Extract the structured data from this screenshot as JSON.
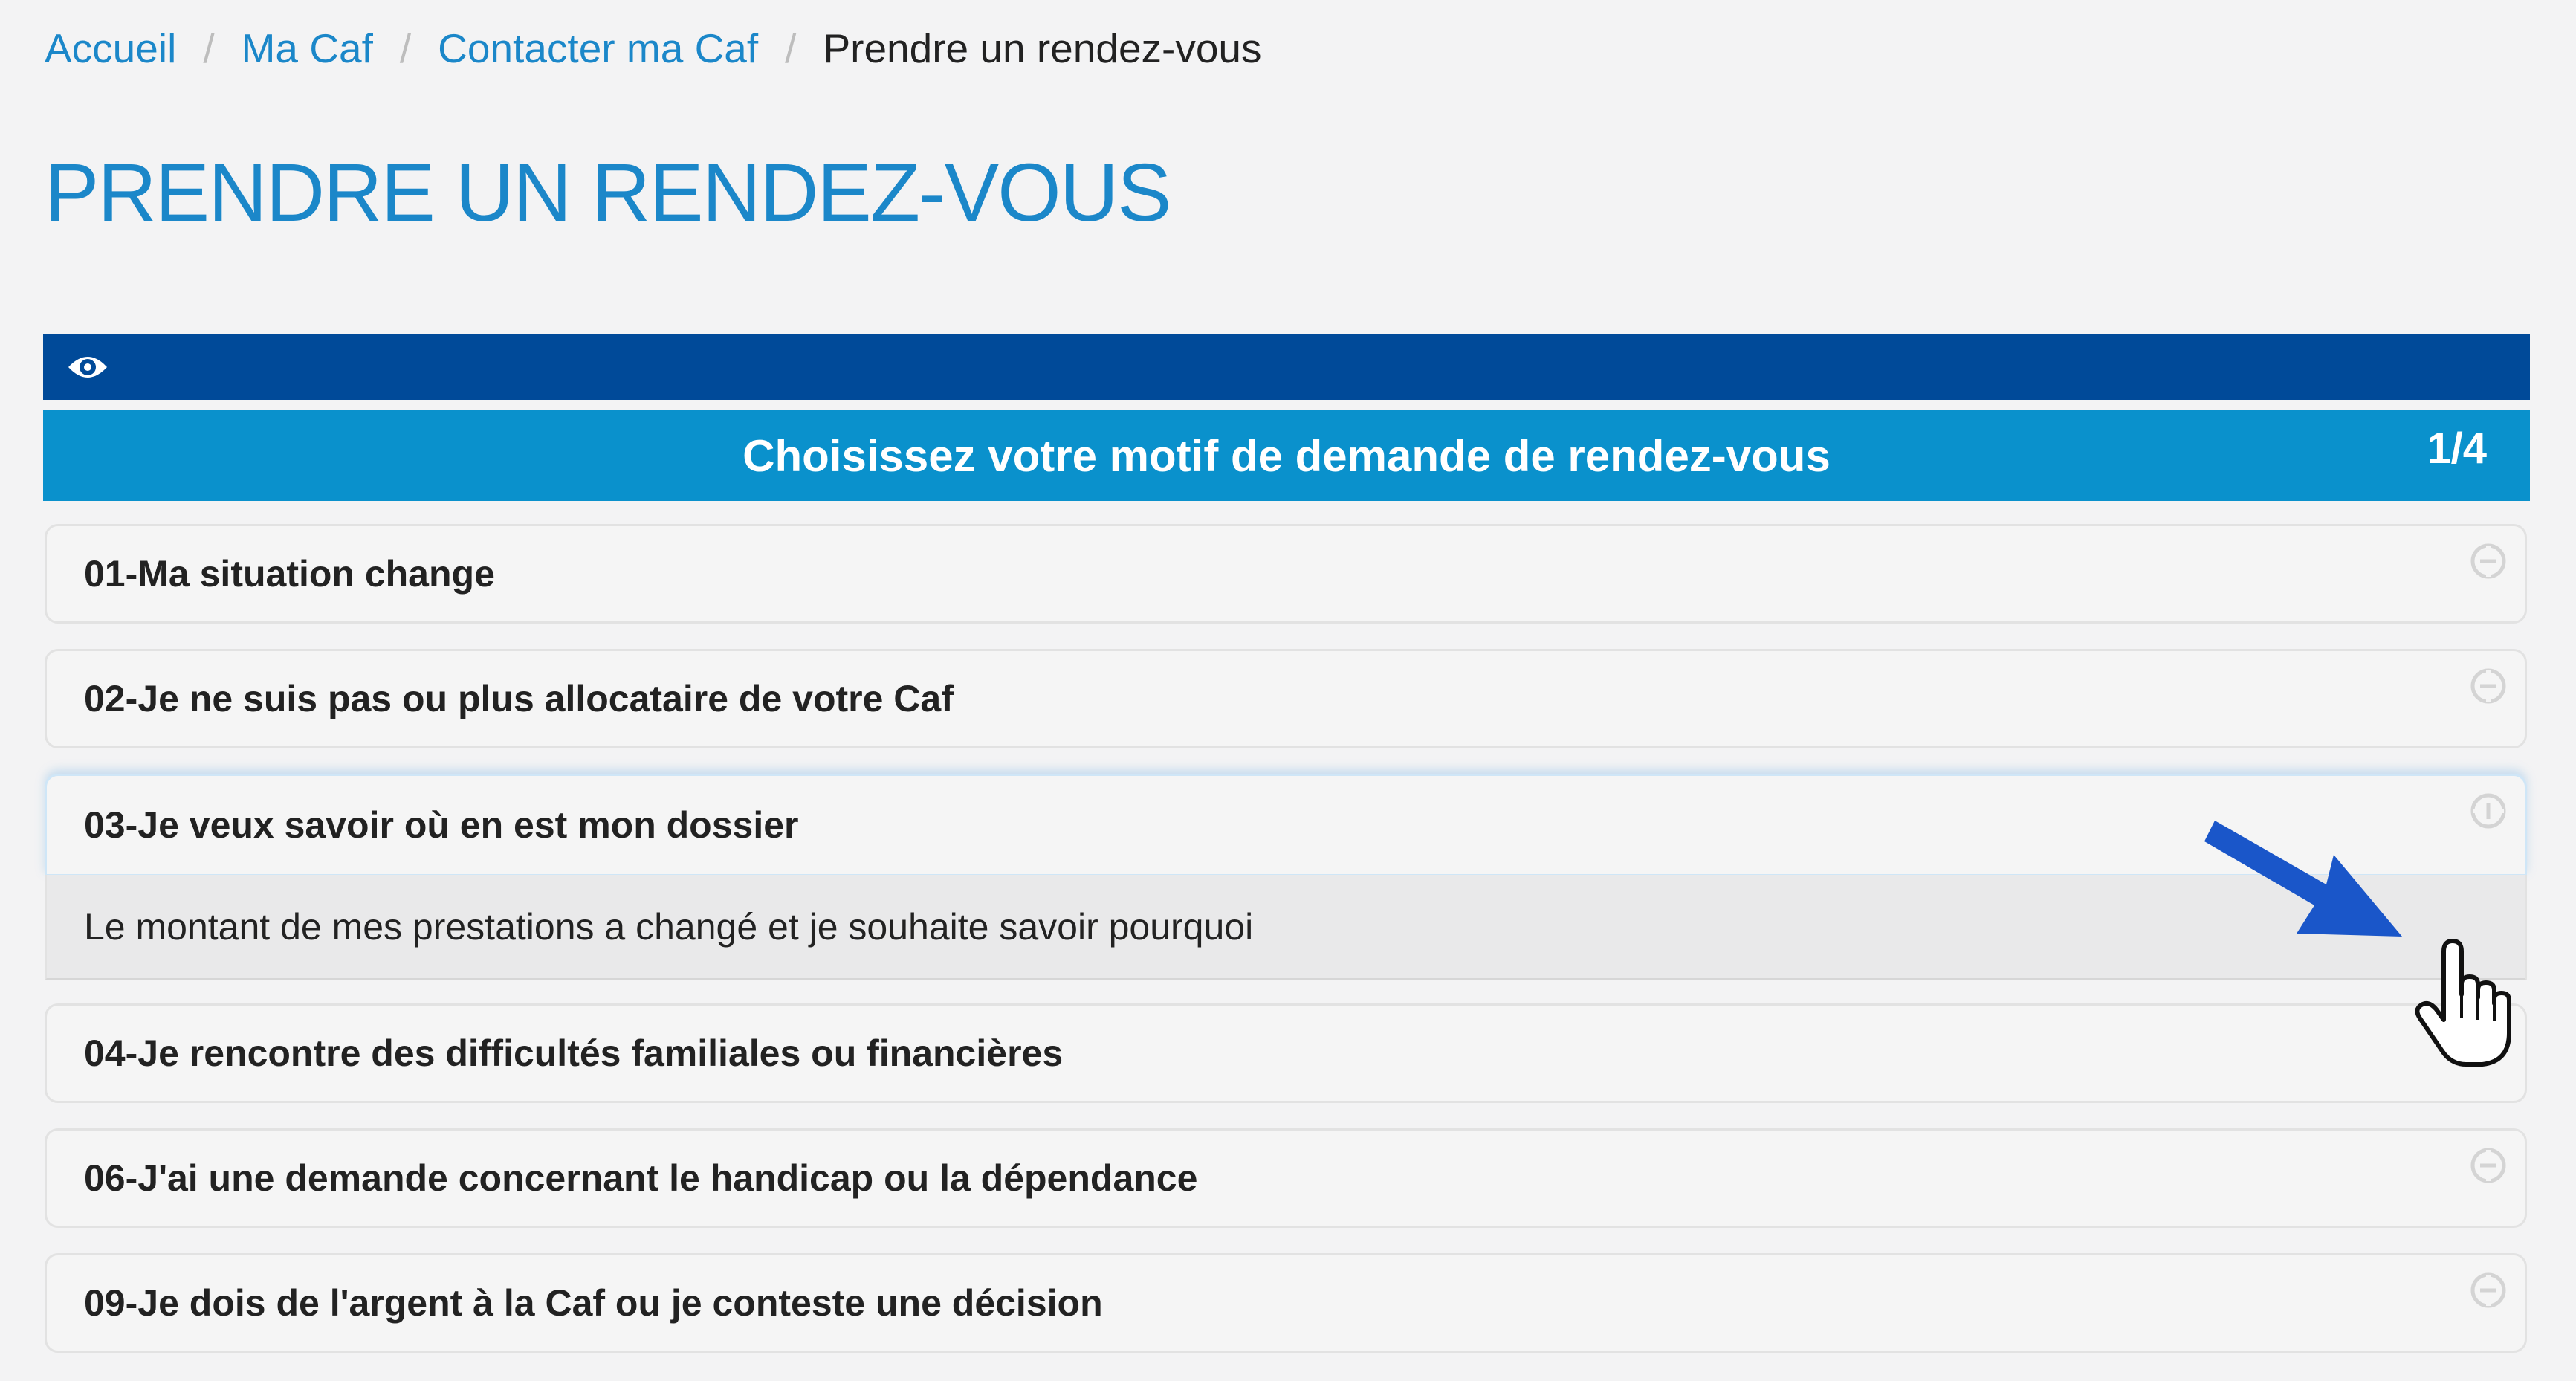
{
  "breadcrumb": {
    "items": [
      {
        "label": "Accueil"
      },
      {
        "label": "Ma Caf"
      },
      {
        "label": "Contacter ma Caf"
      }
    ],
    "separator": "/",
    "current": "Prendre un rendez-vous"
  },
  "page_title": "PRENDRE UN RENDEZ-VOUS",
  "toolbar": {
    "eye_icon": "eye-icon"
  },
  "step": {
    "title": "Choisissez votre motif de demande de rendez-vous",
    "count": "1/4"
  },
  "motifs": [
    {
      "label": "01-Ma situation change"
    },
    {
      "label": "02-Je ne suis pas ou plus allocataire de votre Caf"
    },
    {
      "label": "03-Je veux savoir où en est mon dossier"
    },
    {
      "label": "04-Je rencontre des difficultés familiales ou financières"
    },
    {
      "label": "06-J'ai une demande concernant le handicap ou la dépendance"
    },
    {
      "label": "09-Je dois de l'argent à la Caf ou je conteste une décision"
    }
  ],
  "expanded_motif": {
    "sub_label": "Le montant de mes prestations a changé et je souhaite savoir pourquoi"
  },
  "colors": {
    "link": "#1b87c9",
    "topbar": "#004a99",
    "stepbar": "#0a91cc",
    "arrow": "#1a56c9"
  }
}
